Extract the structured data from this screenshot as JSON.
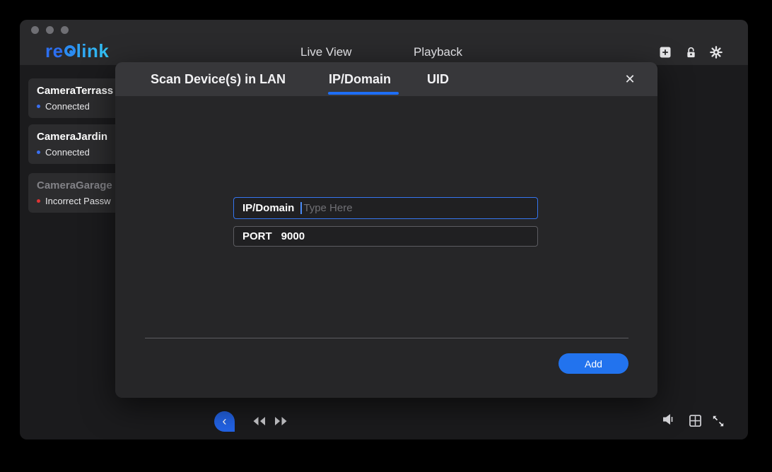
{
  "colors": {
    "accent": "#2273ee",
    "tab_underline": "#1e6ef5",
    "status_connected": "#3a6ff0",
    "status_error": "#e03434",
    "logo_blue": "#2c6ff0",
    "logo_cyan": "#33c4f4"
  },
  "window_controls": {
    "icons": [
      "window-dot",
      "window-dot",
      "window-dot"
    ]
  },
  "topbar": {
    "brand": "reolink",
    "nav": [
      {
        "label": "Live View"
      },
      {
        "label": "Playback"
      }
    ],
    "icons": [
      "add-device-icon",
      "lock-icon",
      "settings-gear-icon"
    ]
  },
  "sidebar": {
    "cameras": [
      {
        "name": "CameraTerrass",
        "status": "Connected",
        "state": "ok"
      },
      {
        "name": "CameraJardin",
        "status": "Connected",
        "state": "ok"
      },
      {
        "name": "CameraGarage",
        "status": "Incorrect Passw",
        "state": "error"
      }
    ]
  },
  "modal": {
    "tabs": [
      {
        "label": "Scan Device(s) in LAN",
        "active": false
      },
      {
        "label": "IP/Domain",
        "active": true
      },
      {
        "label": "UID",
        "active": false
      }
    ],
    "close_glyph": "✕",
    "ip_field": {
      "label": "IP/Domain",
      "placeholder": "Type Here",
      "value": ""
    },
    "port_field": {
      "label": "PORT",
      "value": "9000"
    },
    "add_button_label": "Add"
  },
  "player_bar": {
    "collapse_glyph": "‹",
    "icons": [
      "rewind-icon",
      "fast-forward-icon",
      "volume-icon",
      "layout-grid-icon",
      "fullscreen-icon"
    ]
  }
}
